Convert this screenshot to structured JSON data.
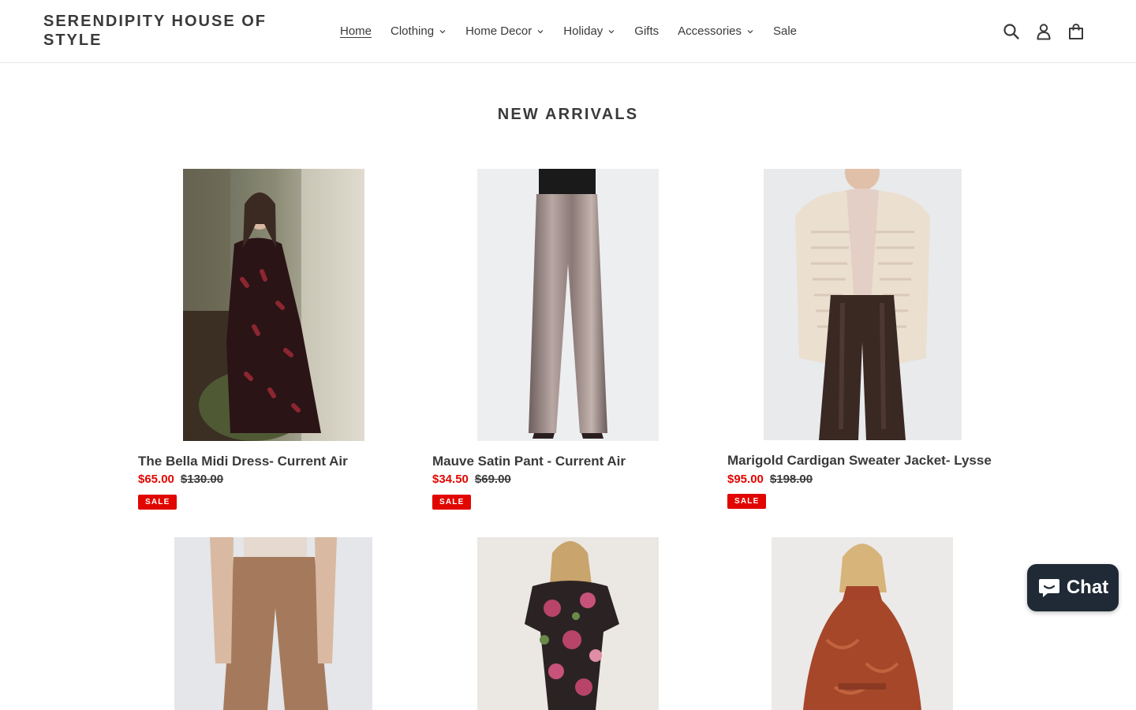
{
  "header": {
    "logo_text": "SERENDIPITY HOUSE OF STYLE",
    "nav": [
      {
        "label": "Home",
        "active": true,
        "dropdown": false
      },
      {
        "label": "Clothing",
        "active": false,
        "dropdown": true
      },
      {
        "label": "Home Decor",
        "active": false,
        "dropdown": true
      },
      {
        "label": "Holiday",
        "active": false,
        "dropdown": true
      },
      {
        "label": "Gifts",
        "active": false,
        "dropdown": false
      },
      {
        "label": "Accessories",
        "active": false,
        "dropdown": true
      },
      {
        "label": "Sale",
        "active": false,
        "dropdown": false
      }
    ],
    "icons": [
      "search-icon",
      "account-icon",
      "cart-icon"
    ]
  },
  "section": {
    "title": "NEW ARRIVALS"
  },
  "products": [
    {
      "title": "The Bella Midi Dress- Current Air",
      "sale_price": "$65.00",
      "regular_price": "$130.00",
      "badge": "SALE"
    },
    {
      "title": "Mauve Satin Pant - Current Air",
      "sale_price": "$34.50",
      "regular_price": "$69.00",
      "badge": "SALE"
    },
    {
      "title": "Marigold Cardigan Sweater Jacket- Lysse",
      "sale_price": "$95.00",
      "regular_price": "$198.00",
      "badge": "SALE"
    },
    {
      "title": "",
      "sale_price": "",
      "regular_price": "",
      "badge": ""
    },
    {
      "title": "",
      "sale_price": "",
      "regular_price": "",
      "badge": ""
    },
    {
      "title": "",
      "sale_price": "",
      "regular_price": "",
      "badge": ""
    }
  ],
  "chat": {
    "label": "Chat"
  },
  "colors": {
    "sale_red": "#e10600",
    "text": "#3a3a3a",
    "chat_bg": "#1f2a36"
  }
}
